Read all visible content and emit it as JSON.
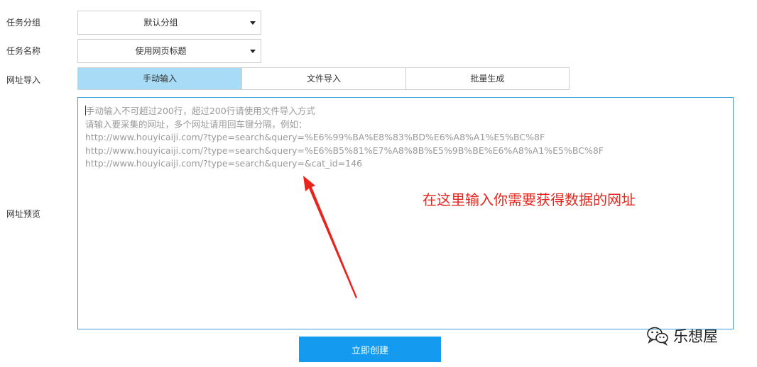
{
  "form": {
    "group_label": "任务分组",
    "group_value": "默认分组",
    "name_label": "任务名称",
    "name_value": "使用网页标题",
    "import_label": "网址导入",
    "import_tabs": [
      {
        "label": "手动输入",
        "active": true
      },
      {
        "label": "文件导入",
        "active": false
      },
      {
        "label": "批量生成",
        "active": false
      }
    ],
    "preview_label": "网址预览",
    "placeholder_lines": [
      "手动输入不可超过200行，超过200行请使用文件导入方式",
      "请输入要采集的网址，多个网址请用回车键分隔，例如：",
      "http://www.houyicaiji.com/?type=search&query=%E6%99%BA%E8%83%BD%E6%A8%A1%E5%BC%8F",
      "http://www.houyicaiji.com/?type=search&query=%E6%B5%81%E7%A8%8B%E5%9B%BE%E6%A8%A1%E5%BC%8F",
      "http://www.houyicaiji.com/?type=search&query=&cat_id=146"
    ],
    "submit_label": "立即创建"
  },
  "annotation": {
    "text": "在这里输入你需要获得数据的网址",
    "color": "#e8251c"
  },
  "watermark": {
    "icon": "wechat-icon",
    "text": "乐想屋"
  },
  "colors": {
    "active_tab": "#a8dcf6",
    "primary_button": "#149bf0",
    "textarea_border": "#3a9ad9",
    "placeholder_text": "#9a9a9a"
  }
}
